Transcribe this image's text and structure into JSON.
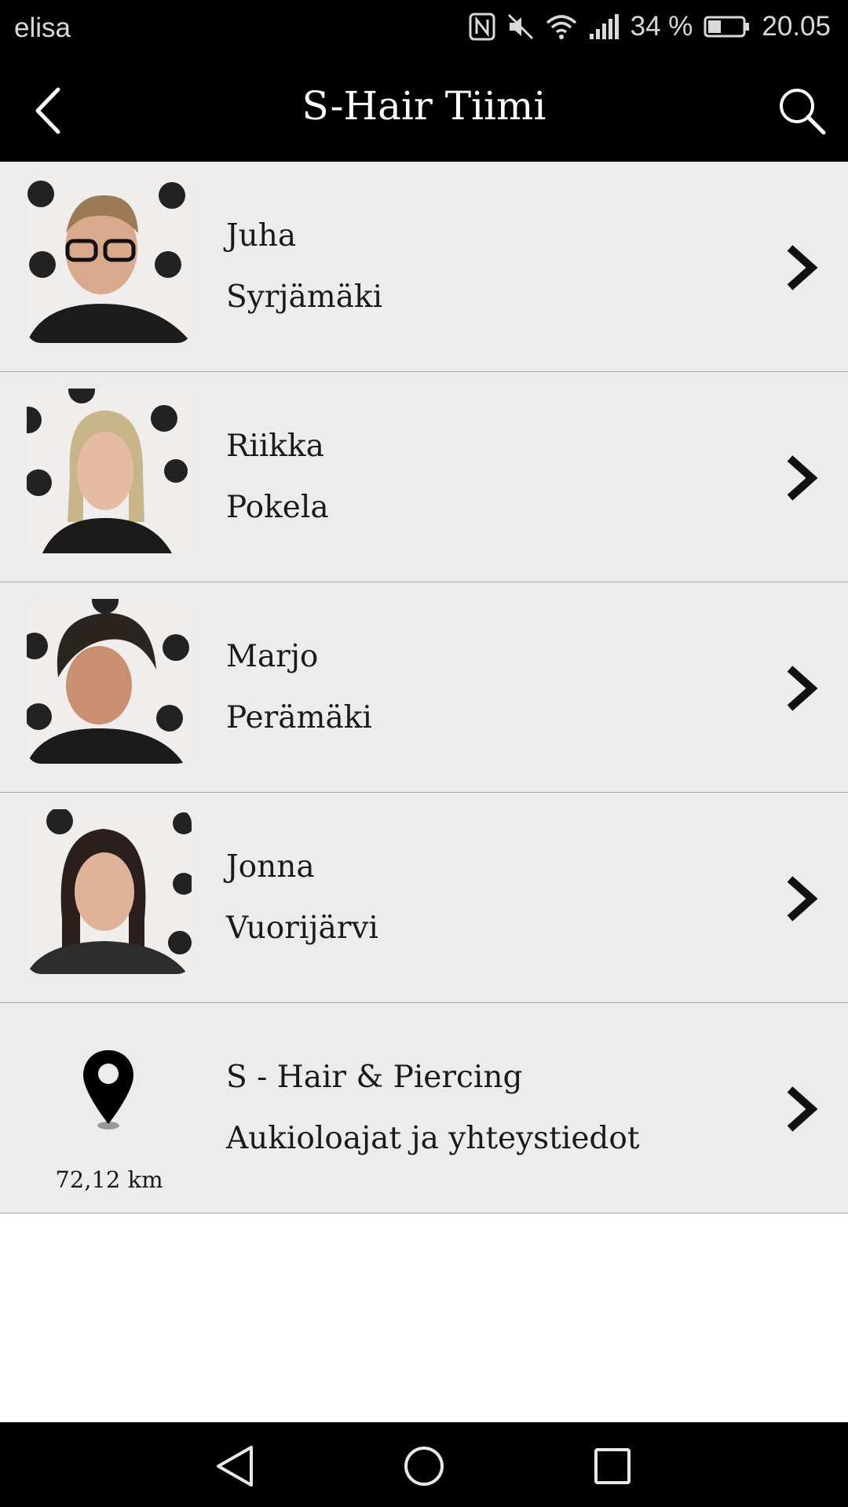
{
  "status_bar": {
    "carrier": "elisa",
    "battery": "34 %",
    "time": "20.05",
    "icons": [
      "nfc-icon",
      "mute-icon",
      "wifi-icon",
      "signal-icon",
      "battery-icon"
    ]
  },
  "app_bar": {
    "title": "S-Hair Tiimi",
    "icons": [
      "back-arrow-icon",
      "search-icon"
    ]
  },
  "team": [
    {
      "first": "Juha",
      "last": "Syrjämäki"
    },
    {
      "first": "Riikka",
      "last": "Pokela"
    },
    {
      "first": "Marjo",
      "last": "Perämäki"
    },
    {
      "first": "Jonna",
      "last": "Vuorijärvi"
    }
  ],
  "location": {
    "name": "S - Hair & Piercing",
    "subtitle": "Aukioloajat ja yhteystiedot",
    "distance": "72,12 km"
  },
  "nav_bar": {
    "icons": [
      "nav-back-icon",
      "nav-home-icon",
      "nav-recents-icon"
    ]
  },
  "colors": {
    "bar": "#000000",
    "row": "#ececec",
    "divider": "#a9a9a9"
  }
}
